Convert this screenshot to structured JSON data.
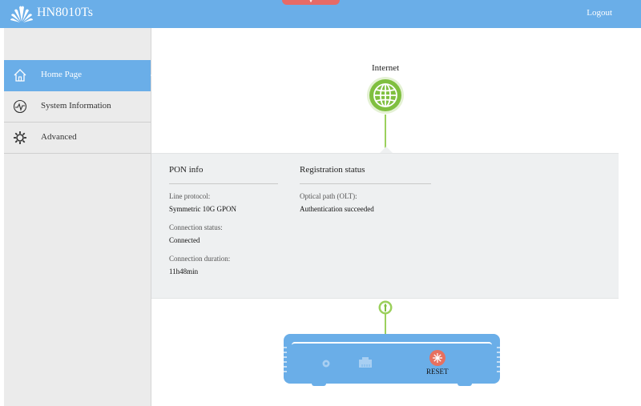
{
  "header": {
    "model": "HN8010Ts",
    "logout_label": "Logout",
    "logo_icon": "huawei-logo",
    "colors": {
      "bar": "#6aaee8",
      "alert": "#e66a66"
    }
  },
  "sidebar": {
    "items": [
      {
        "label": "Home Page",
        "icon": "home-icon",
        "active": true
      },
      {
        "label": "System Information",
        "icon": "pulse-icon",
        "active": false
      },
      {
        "label": "Advanced",
        "icon": "gear-icon",
        "active": false
      }
    ]
  },
  "topology": {
    "internet_label": "Internet",
    "globe_color": "#7fbf3f",
    "reset_label": "RESET"
  },
  "pon_info": {
    "title": "PON info",
    "line_protocol_label": "Line protocol:",
    "line_protocol_value": "Symmetric 10G GPON",
    "connection_status_label": "Connection status:",
    "connection_status_value": "Connected",
    "connection_duration_label": "Connection duration:",
    "connection_duration_value": "11h48min"
  },
  "registration": {
    "title": "Registration status",
    "optical_path_label": "Optical path (OLT):",
    "optical_path_value": "Authentication succeeded"
  }
}
